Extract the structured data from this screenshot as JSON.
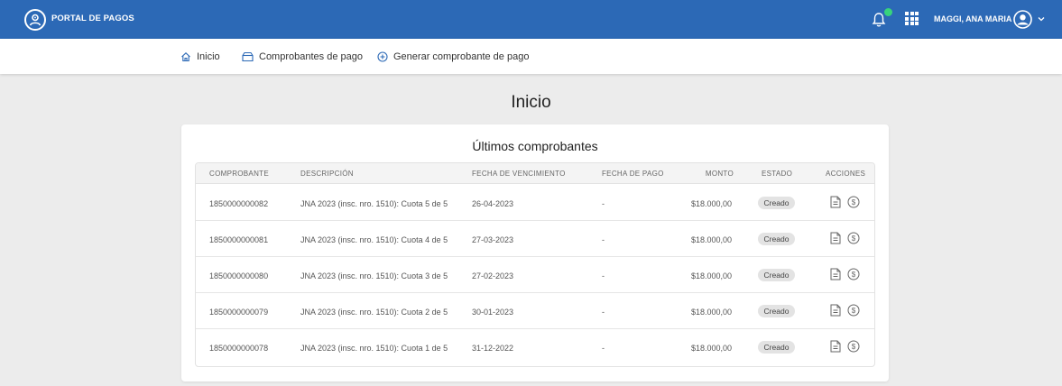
{
  "app": {
    "brand": "PORTAL DE PAGOS",
    "user": "MAGGI, ANA MARIA",
    "colors": {
      "header": "#2c69b6",
      "notification_dot": "#37d37c"
    }
  },
  "nav": {
    "items": [
      {
        "label": "Inicio",
        "icon": "home-icon"
      },
      {
        "label": "Comprobantes de pago",
        "icon": "archive-icon"
      },
      {
        "label": "Generar comprobante de pago",
        "icon": "plus-circle-icon"
      }
    ]
  },
  "page": {
    "title": "Inicio"
  },
  "card": {
    "title": "Últimos comprobantes",
    "columns": [
      "COMPROBANTE",
      "DESCRIPCIÓN",
      "FECHA DE VENCIMIENTO",
      "FECHA DE PAGO",
      "MONTO",
      "ESTADO",
      "ACCIONES"
    ],
    "rows": [
      {
        "comprobante": "1850000000082",
        "descripcion": "JNA 2023 (insc. nro. 1510): Cuota 5 de 5",
        "vencimiento": "26-04-2023",
        "pago": "-",
        "monto": "$18.000,00",
        "estado": "Creado"
      },
      {
        "comprobante": "1850000000081",
        "descripcion": "JNA 2023 (insc. nro. 1510): Cuota 4 de 5",
        "vencimiento": "27-03-2023",
        "pago": "-",
        "monto": "$18.000,00",
        "estado": "Creado"
      },
      {
        "comprobante": "1850000000080",
        "descripcion": "JNA 2023 (insc. nro. 1510): Cuota 3 de 5",
        "vencimiento": "27-02-2023",
        "pago": "-",
        "monto": "$18.000,00",
        "estado": "Creado"
      },
      {
        "comprobante": "1850000000079",
        "descripcion": "JNA 2023 (insc. nro. 1510): Cuota 2 de 5",
        "vencimiento": "30-01-2023",
        "pago": "-",
        "monto": "$18.000,00",
        "estado": "Creado"
      },
      {
        "comprobante": "1850000000078",
        "descripcion": "JNA 2023 (insc. nro. 1510): Cuota 1 de 5",
        "vencimiento": "31-12-2022",
        "pago": "-",
        "monto": "$18.000,00",
        "estado": "Creado"
      }
    ]
  }
}
